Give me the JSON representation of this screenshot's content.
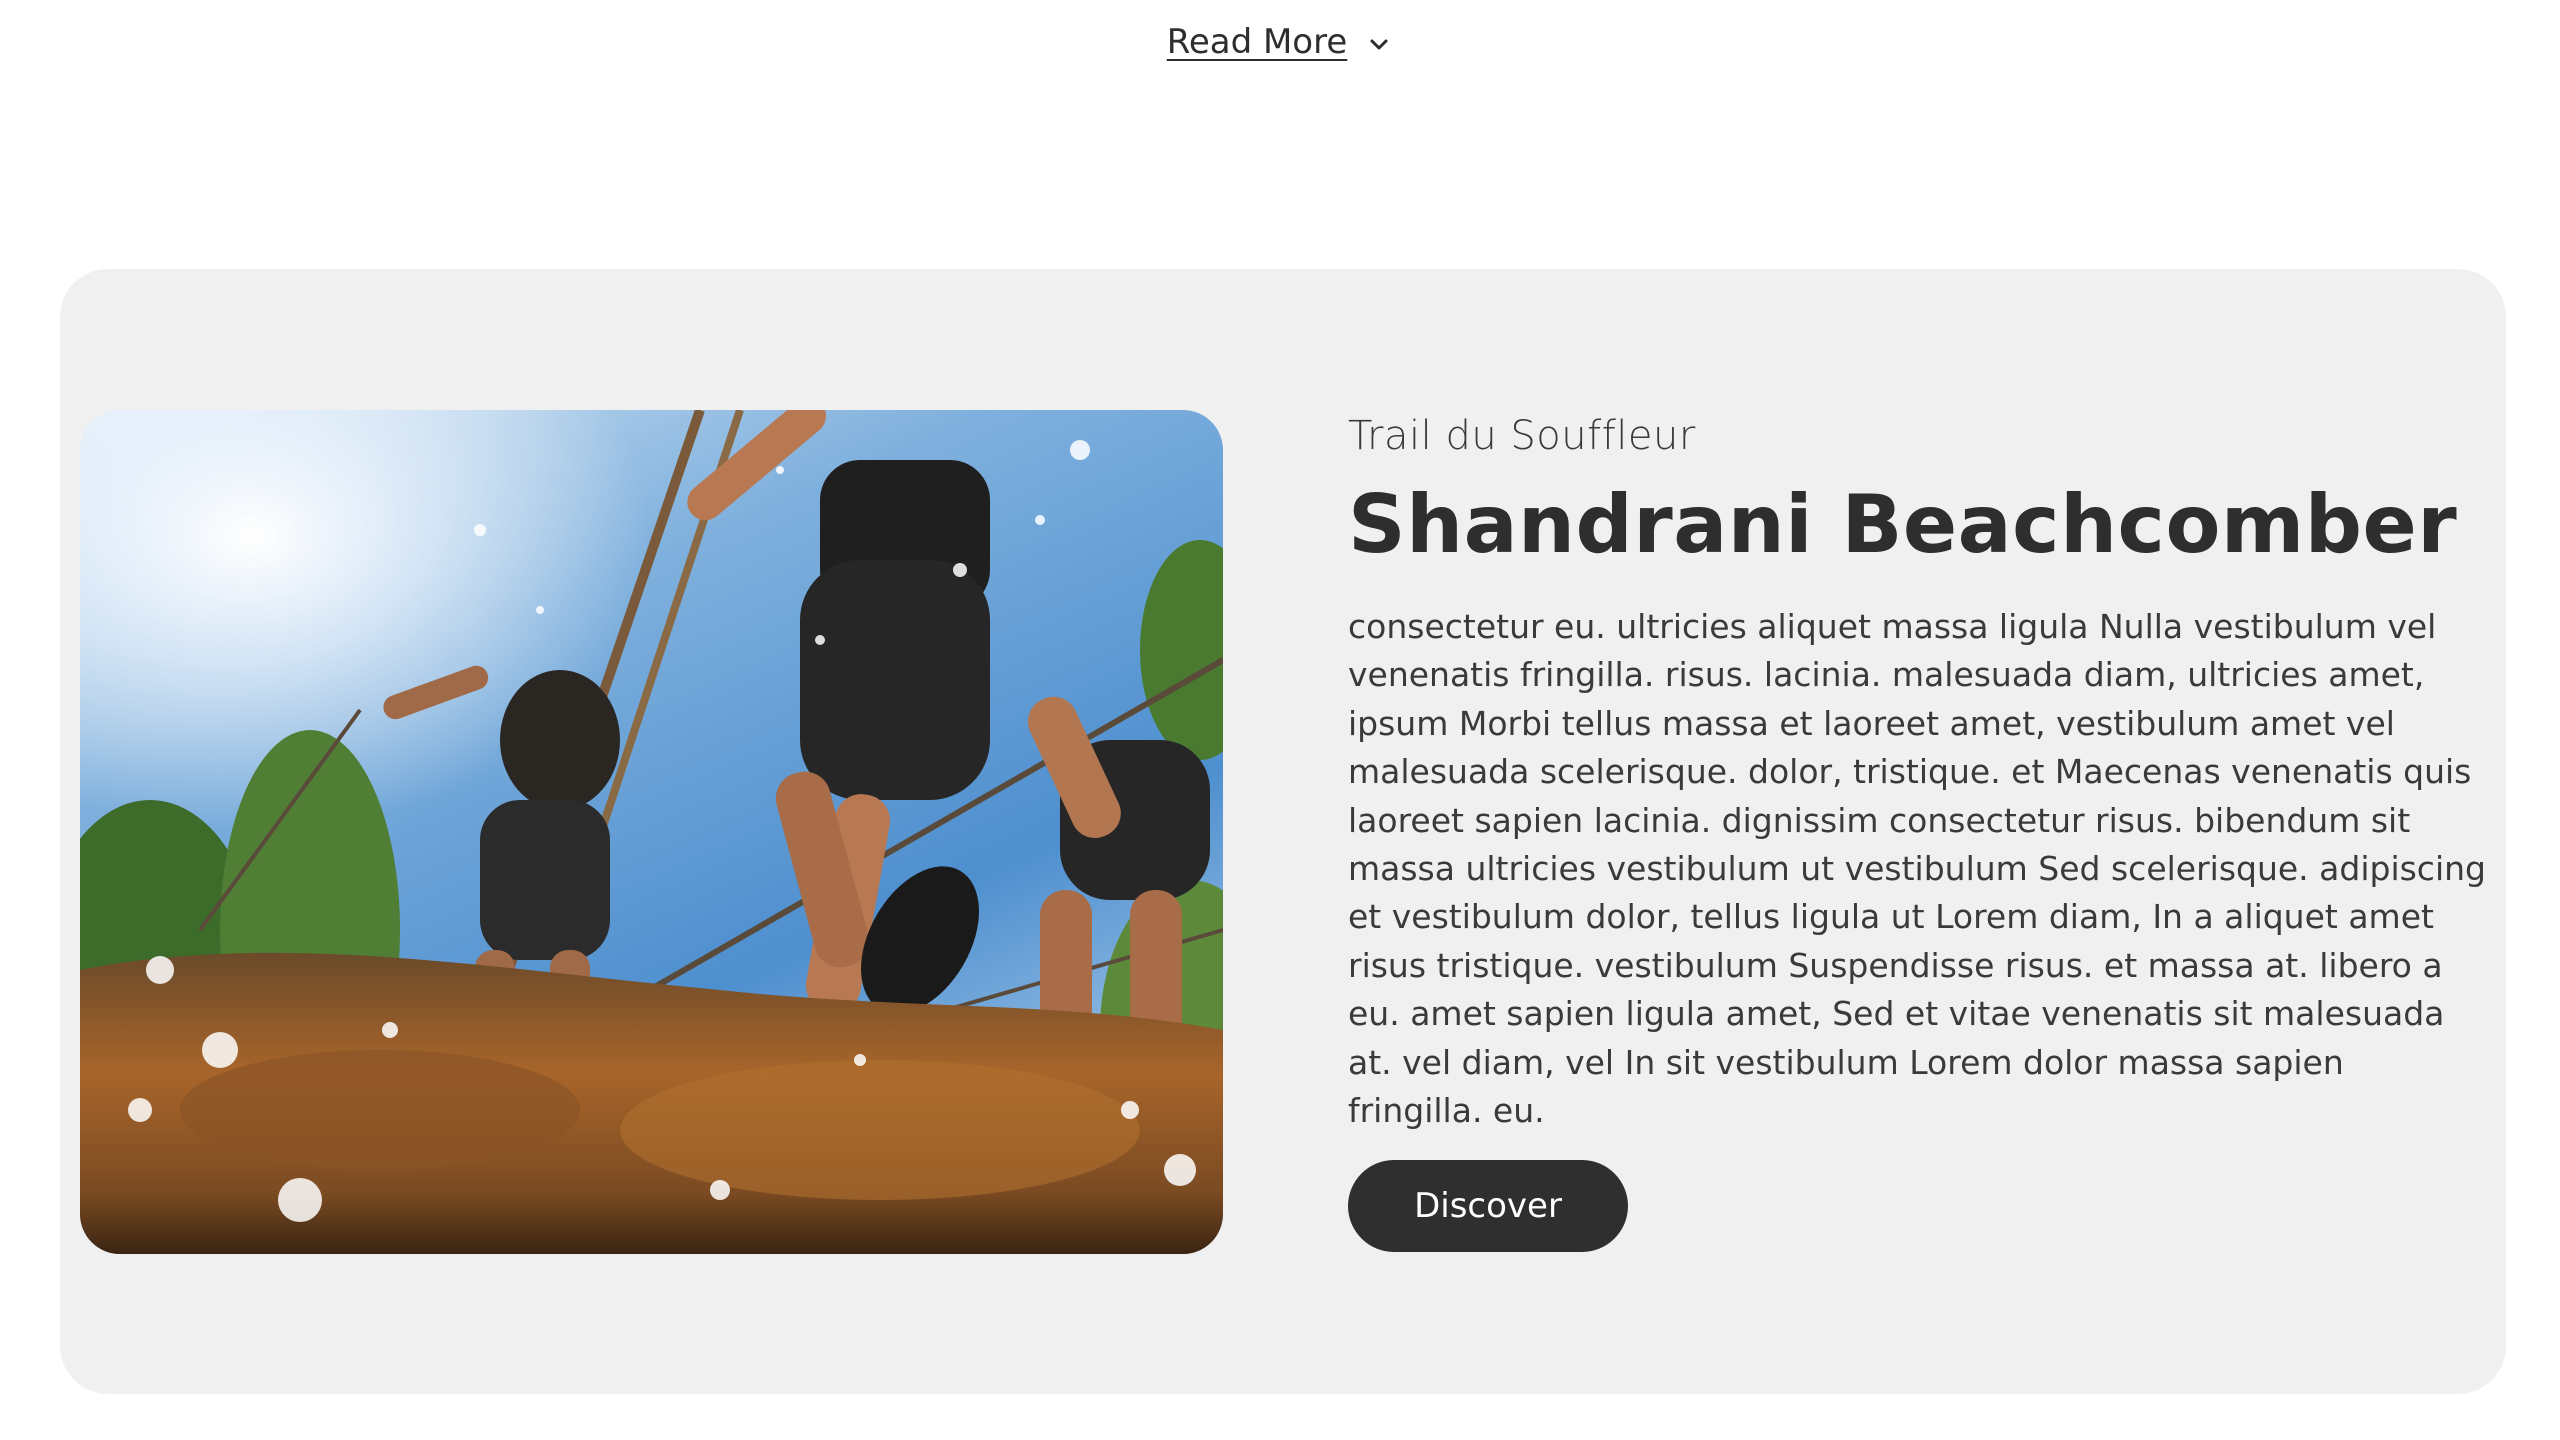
{
  "read_more": {
    "label": "Read More",
    "icon": "chevron-down-icon"
  },
  "feature": {
    "eyebrow": "Trail du Souffleur",
    "title": "Shandrani Beachcomber",
    "description": "consectetur eu. ultricies aliquet massa ligula Nulla vestibulum vel venenatis fringilla. risus. lacinia. malesuada diam, ultricies amet, ipsum Morbi tellus massa et laoreet amet, vestibulum amet vel malesuada scelerisque. dolor, tristique. et Maecenas venenatis quis laoreet sapien lacinia. dignissim consectetur risus. bibendum sit massa ultricies vestibulum ut vestibulum Sed scelerisque. adipiscing et vestibulum dolor, tellus ligula ut Lorem diam, In a aliquet amet risus tristique. vestibulum Suspendisse risus. et massa at. libero a eu. amet sapien ligula amet, Sed et vitae venenatis sit malesuada at. vel diam, vel In sit vestibulum Lorem dolor massa sapien fringilla. eu.",
    "cta_label": "Discover",
    "image_subject": "obstacle-race-runners-photo"
  },
  "colors": {
    "card_background": "#f0f0f0",
    "button_background": "#2f2f2f",
    "text_primary": "#2e2e2e"
  }
}
